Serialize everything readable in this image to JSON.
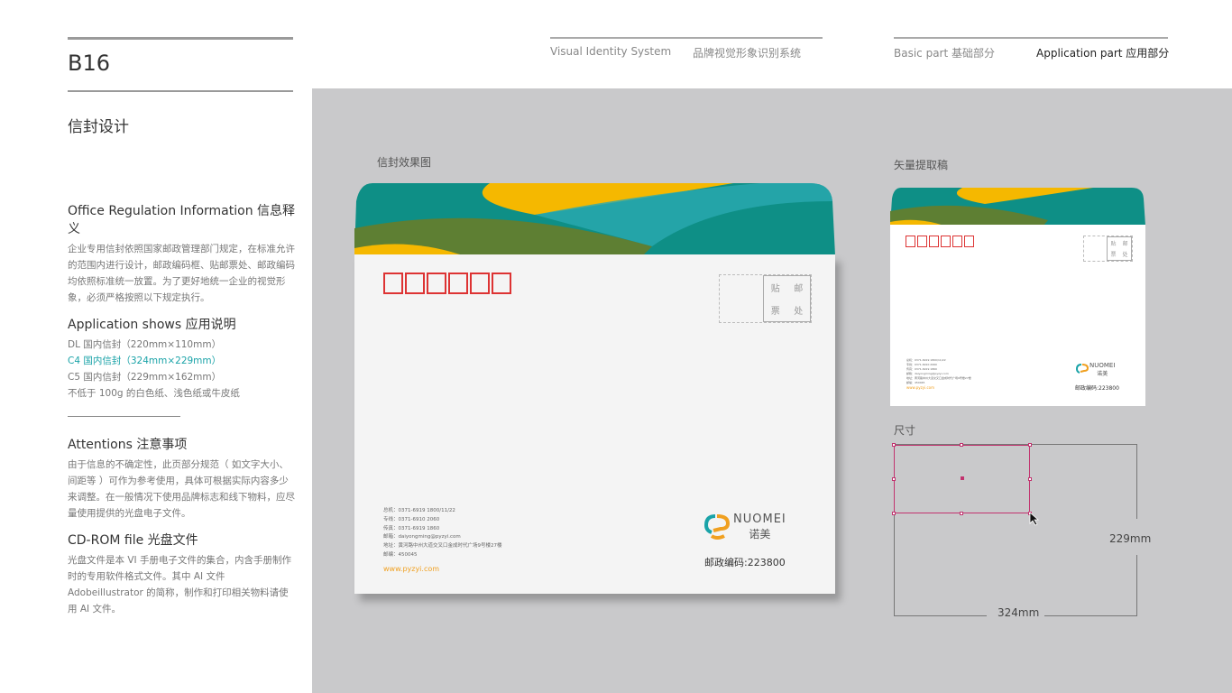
{
  "page": {
    "code": "B16",
    "title": "信封设计"
  },
  "header": {
    "vis_en": "Visual Identity System",
    "vis_cn": "品牌视觉形象识别系统",
    "basic": "Basic part  基础部分",
    "application": "Application part  应用部分"
  },
  "left": {
    "s1_title": "Office Regulation Information 信息释义",
    "s1_body": "企业专用信封依照国家邮政管理部门规定，在标准允许的范围内进行设计，邮政编码框、贴邮票处、邮政编码均依照标准统一放置。为了更好地统一企业的视觉形象，必须严格按照以下规定执行。",
    "s2_title": "Application shows 应用说明",
    "s2_items": [
      "DL 国内信封（220mm×110mm）",
      "C4 国内信封（324mm×229mm）",
      "C5 国内信封（229mm×162mm）",
      "不低于 100g 的白色纸、浅色纸或牛皮纸"
    ],
    "s3_title": "Attentions 注意事项",
    "s3_body": "由于信息的不确定性，此页部分规范（ 如文字大小、间距等 ）可作为参考使用，具体可根据实际内容多少来调整。在一般情况下使用品牌标志和线下物料，应尽量使用提供的光盘电子文件。",
    "s4_title": "CD-ROM file 光盘文件",
    "s4_body": "光盘文件是本 VI 手册电子文件的集合，内含手册制作时的专用软件格式文件。其中 AI 文件 Adobeillustrator 的简称，制作和打印相关物料请使用 AI 文件。"
  },
  "main": {
    "effect_label": "信封效果图",
    "vector_label": "矢量提取稿",
    "size_label": "尺寸",
    "stamp": [
      "贴",
      "邮",
      "票",
      "处"
    ],
    "info": [
      "总机：0371-6919 1800/11/22",
      "专线：0371-6910 2060",
      "传真：0371-6919 1860",
      "邮箱：daiyongming@pyzyi.com",
      "地址：黄河路中州大道交叉口金成时代广场9号楼27楼",
      "邮编：450045"
    ],
    "website": "www.pyzyi.com",
    "brand_en": "NUOMEI",
    "brand_cn": "诺美",
    "postcode": "邮政编码:223800",
    "width": "324mm",
    "height": "229mm"
  },
  "colors": {
    "teal": "#0e8f86",
    "green": "#5e7f33",
    "yellow": "#f5b800",
    "lightteal": "#2aa9b0",
    "accent_text": "#1aa3a8",
    "code_red": "#d33",
    "guide": "#c2336f"
  }
}
